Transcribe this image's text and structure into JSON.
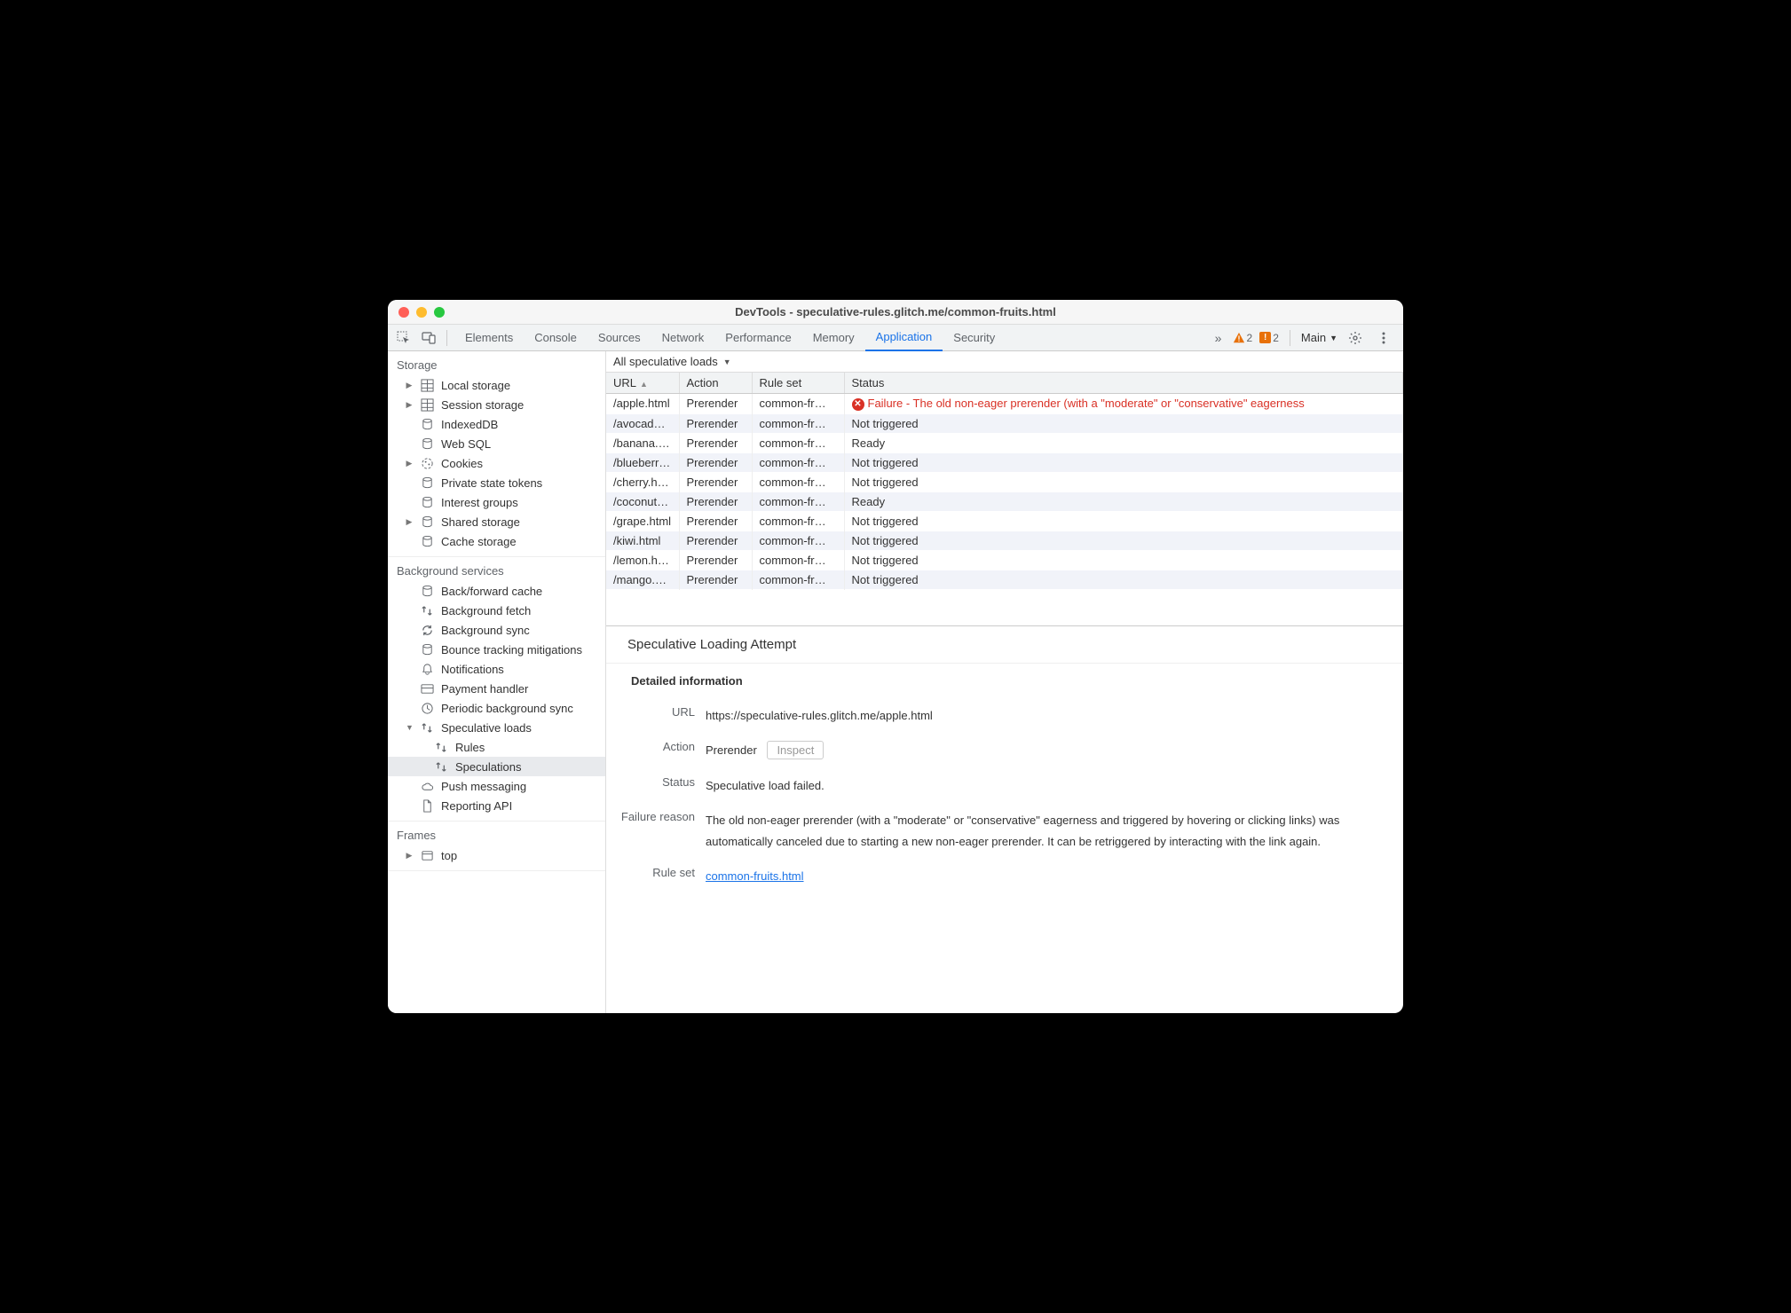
{
  "window": {
    "title": "DevTools - speculative-rules.glitch.me/common-fruits.html"
  },
  "tabs": [
    "Elements",
    "Console",
    "Sources",
    "Network",
    "Performance",
    "Memory",
    "Application",
    "Security"
  ],
  "active_tab": "Application",
  "overflow_icon": "»",
  "warnings": {
    "yellow": "2",
    "orange": "2"
  },
  "target_dropdown": "Main",
  "sidebar": {
    "storage_title": "Storage",
    "storage_items": [
      {
        "label": "Local storage",
        "expandable": true,
        "icon": "grid"
      },
      {
        "label": "Session storage",
        "expandable": true,
        "icon": "grid"
      },
      {
        "label": "IndexedDB",
        "expandable": false,
        "icon": "db"
      },
      {
        "label": "Web SQL",
        "expandable": false,
        "icon": "db"
      },
      {
        "label": "Cookies",
        "expandable": true,
        "icon": "cookie"
      },
      {
        "label": "Private state tokens",
        "expandable": false,
        "icon": "db"
      },
      {
        "label": "Interest groups",
        "expandable": false,
        "icon": "db"
      },
      {
        "label": "Shared storage",
        "expandable": true,
        "icon": "db"
      },
      {
        "label": "Cache storage",
        "expandable": false,
        "icon": "db"
      }
    ],
    "bg_title": "Background services",
    "bg_items": [
      {
        "label": "Back/forward cache",
        "icon": "db"
      },
      {
        "label": "Background fetch",
        "icon": "exchange"
      },
      {
        "label": "Background sync",
        "icon": "sync"
      },
      {
        "label": "Bounce tracking mitigations",
        "icon": "db"
      },
      {
        "label": "Notifications",
        "icon": "bell"
      },
      {
        "label": "Payment handler",
        "icon": "card"
      },
      {
        "label": "Periodic background sync",
        "icon": "clock"
      },
      {
        "label": "Speculative loads",
        "icon": "exchange",
        "expandable": true,
        "expanded": true,
        "children": [
          {
            "label": "Rules",
            "icon": "exchange"
          },
          {
            "label": "Speculations",
            "icon": "exchange",
            "selected": true
          }
        ]
      },
      {
        "label": "Push messaging",
        "icon": "cloud"
      },
      {
        "label": "Reporting API",
        "icon": "file"
      }
    ],
    "frames_title": "Frames",
    "frames_items": [
      {
        "label": "top",
        "expandable": true,
        "icon": "frame"
      }
    ]
  },
  "filter": {
    "label": "All speculative loads"
  },
  "columns": [
    "URL",
    "Action",
    "Rule set",
    "Status"
  ],
  "rows": [
    {
      "url": "/apple.html",
      "action": "Prerender",
      "ruleset": "common-fr…",
      "status": "Failure - The old non-eager prerender (with a \"moderate\" or \"conservative\" eagerness",
      "fail": true
    },
    {
      "url": "/avocad…",
      "action": "Prerender",
      "ruleset": "common-fr…",
      "status": "Not triggered"
    },
    {
      "url": "/banana.…",
      "action": "Prerender",
      "ruleset": "common-fr…",
      "status": "Ready"
    },
    {
      "url": "/blueberr…",
      "action": "Prerender",
      "ruleset": "common-fr…",
      "status": "Not triggered"
    },
    {
      "url": "/cherry.h…",
      "action": "Prerender",
      "ruleset": "common-fr…",
      "status": "Not triggered"
    },
    {
      "url": "/coconut…",
      "action": "Prerender",
      "ruleset": "common-fr…",
      "status": "Ready"
    },
    {
      "url": "/grape.html",
      "action": "Prerender",
      "ruleset": "common-fr…",
      "status": "Not triggered"
    },
    {
      "url": "/kiwi.html",
      "action": "Prerender",
      "ruleset": "common-fr…",
      "status": "Not triggered"
    },
    {
      "url": "/lemon.h…",
      "action": "Prerender",
      "ruleset": "common-fr…",
      "status": "Not triggered"
    },
    {
      "url": "/mango.…",
      "action": "Prerender",
      "ruleset": "common-fr…",
      "status": "Not triggered"
    }
  ],
  "detail": {
    "title": "Speculative Loading Attempt",
    "section": "Detailed information",
    "fields": {
      "url_label": "URL",
      "url_value": "https://speculative-rules.glitch.me/apple.html",
      "action_label": "Action",
      "action_value": "Prerender",
      "inspect_btn": "Inspect",
      "status_label": "Status",
      "status_value": "Speculative load failed.",
      "reason_label": "Failure reason",
      "reason_value": "The old non-eager prerender (with a \"moderate\" or \"conservative\" eagerness and triggered by hovering or clicking links) was automatically canceled due to starting a new non-eager prerender. It can be retriggered by interacting with the link again.",
      "ruleset_label": "Rule set",
      "ruleset_value": "common-fruits.html"
    }
  }
}
